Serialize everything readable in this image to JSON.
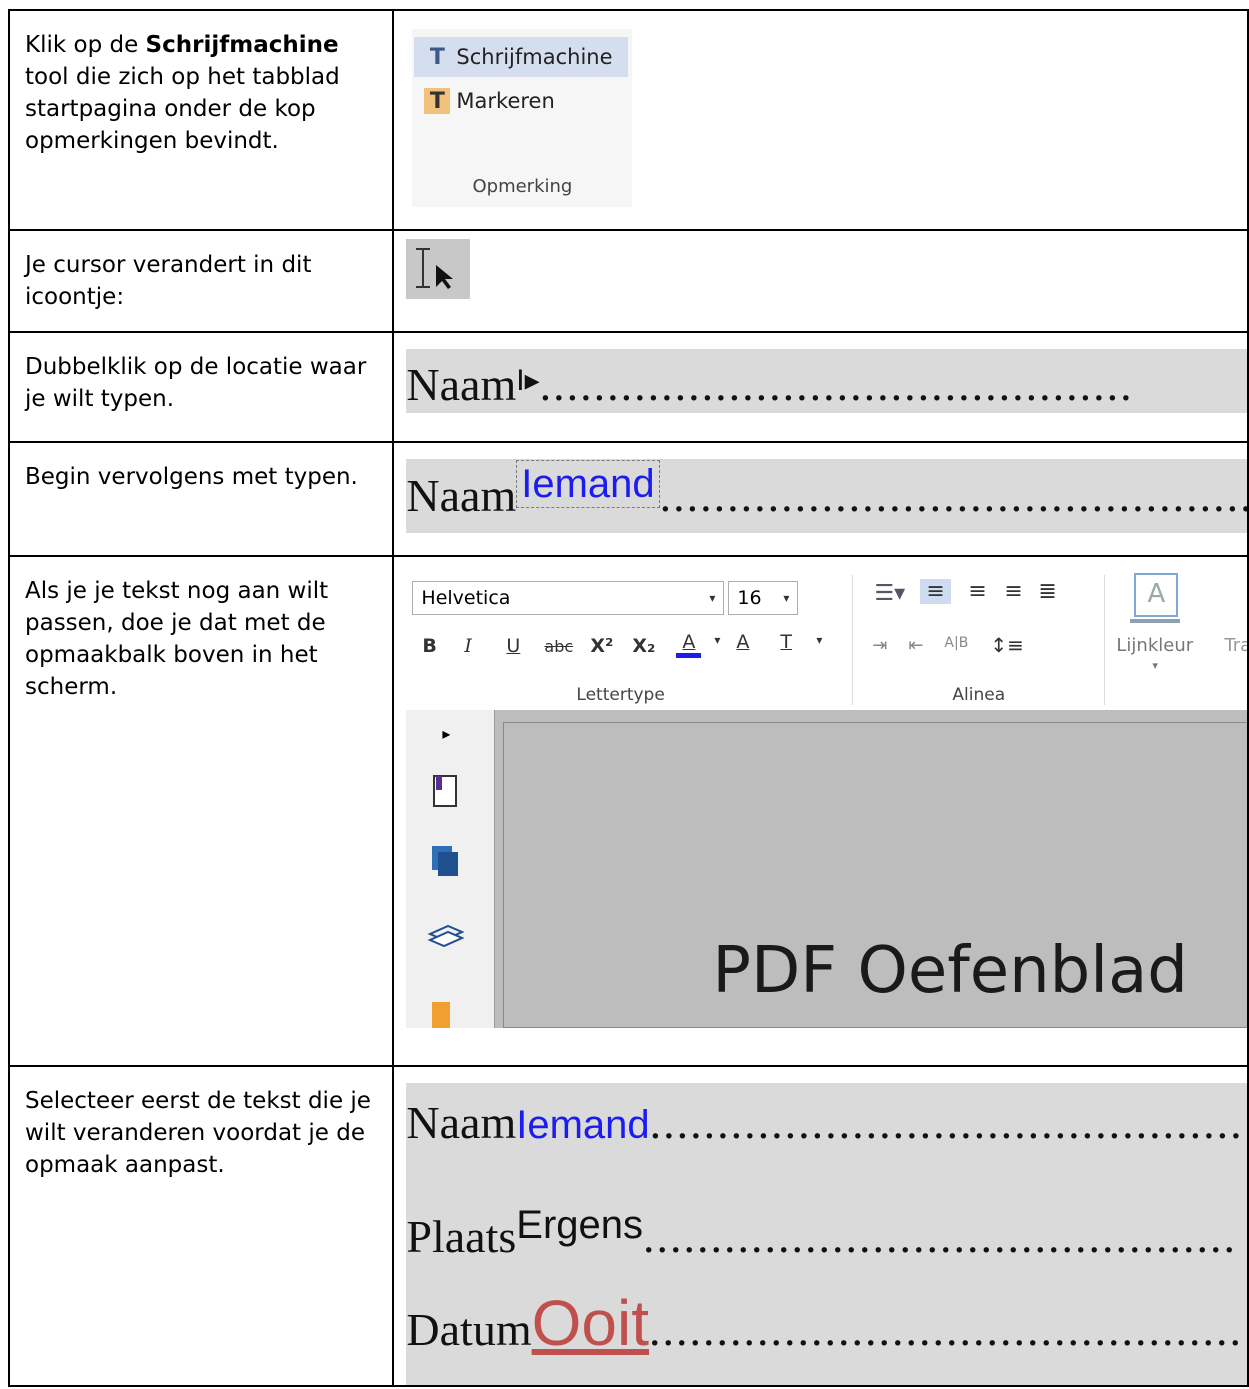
{
  "steps": [
    {
      "pre": "Klik op de ",
      "bold": "Schrijfmachine",
      "post": " tool die zich op het tabblad startpagina  onder de kop opmerkingen bevindt."
    },
    {
      "text": "Je cursor verandert in dit icoontje:"
    },
    {
      "text": "Dubbelklik op de locatie waar je wilt typen."
    },
    {
      "text": "Begin vervolgens met typen."
    },
    {
      "text": "Als je je tekst nog aan wilt passen, doe je dat met de opmaakbalk boven in het scherm."
    },
    {
      "text": "Selecteer eerst de tekst die je wilt veranderen voordat je de opmaak aanpast."
    }
  ],
  "ribbon": {
    "typewriter": "Schrijfmachine",
    "highlight": "Markeren",
    "group": "Opmerking"
  },
  "strip": {
    "name": "Naam",
    "place": "Plaats",
    "date": "Datum",
    "dots": "............................................",
    "typed_name": "Iemand",
    "typed_place": "Ergens",
    "typed_date": "Ooit"
  },
  "format": {
    "font": "Helvetica",
    "size": "16",
    "group_font": "Lettertype",
    "group_para": "Alinea",
    "line_color": "Lijnkleur",
    "trans": "Trans",
    "bold": "B",
    "italic": "I",
    "underline": "U",
    "strike": "abc",
    "sup": "X²",
    "sub": "X₂",
    "fontcolor": "A",
    "spacing": "A",
    "textdir": "T",
    "pdf_title": "PDF Oefenblad"
  },
  "colors": {
    "accent": "#2e75b5",
    "typed_blue": "#1c1cf0",
    "date_red": "#c0504d",
    "highlight": "#d4deef"
  }
}
